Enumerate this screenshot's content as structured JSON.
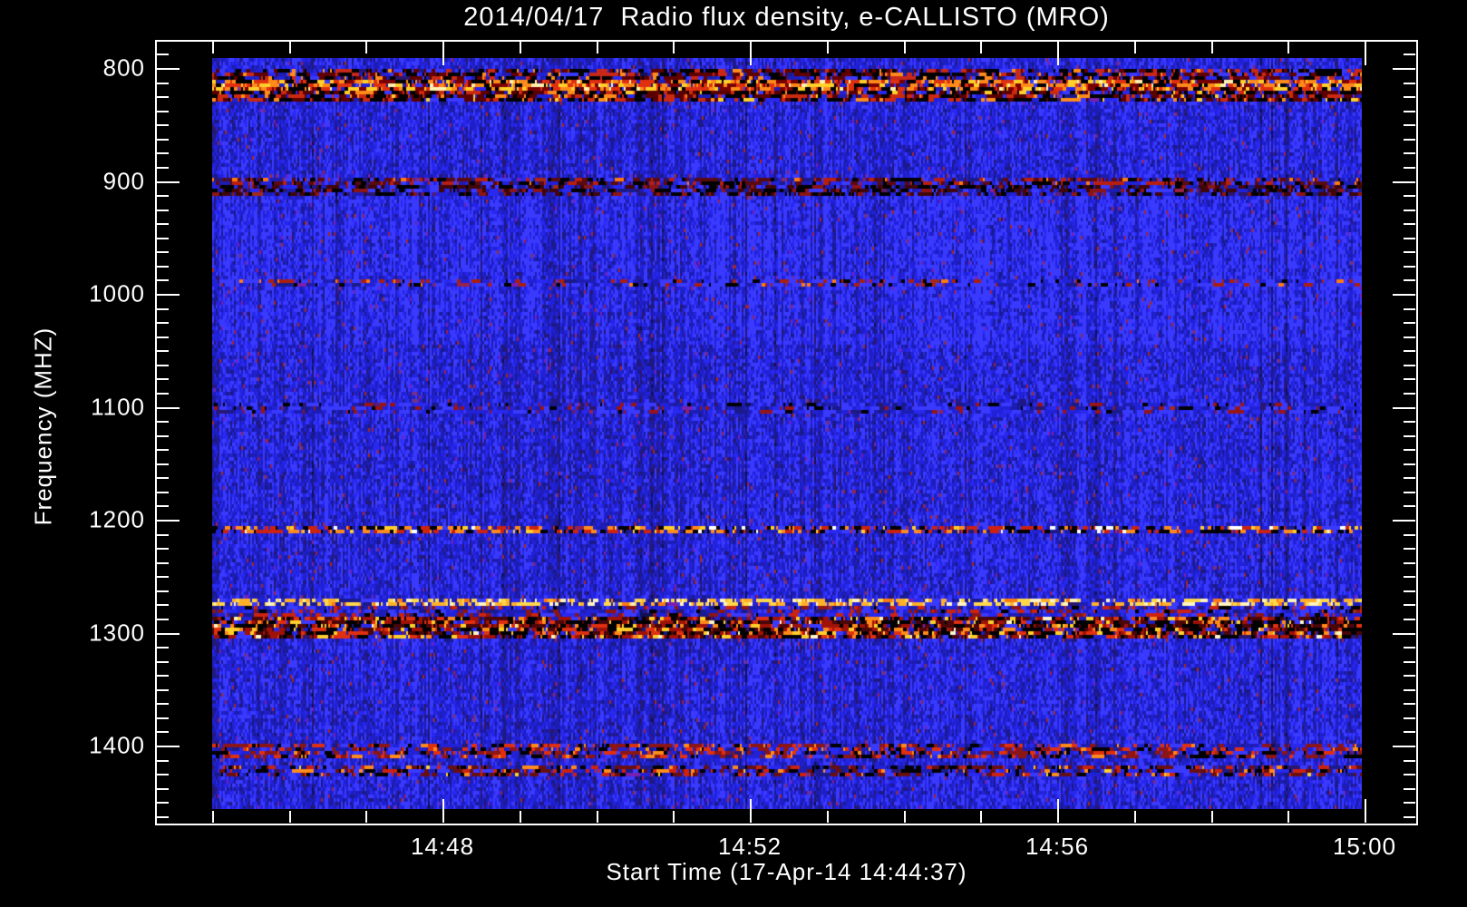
{
  "window": {
    "background_color": "#000000",
    "frame_color": "#ffffff",
    "text_color": "#ffffff"
  },
  "header": {
    "title": "2014/04/17  Radio flux density, e-CALLISTO (MRO)"
  },
  "chart_data": {
    "type": "heatmap",
    "title": "2014/04/17  Radio flux density, e-CALLISTO (MRO)",
    "xlabel": "Start Time (17-Apr-14 14:44:37)",
    "ylabel": "Frequency (MHZ)",
    "x_tick_labels": [
      "14:48",
      "14:52",
      "14:56",
      "15:00"
    ],
    "x_major_tick_minutes": [
      0,
      4,
      8,
      12
    ],
    "x_minor_tick_interval_minutes": 1,
    "x_data_span_minutes": [
      -3,
      12
    ],
    "y_tick_values_mhz": [
      800,
      900,
      1000,
      1100,
      1200,
      1300,
      1400
    ],
    "y_minor_tick_step_mhz": 12.5,
    "y_axis_orientation": "frequency increases downward",
    "y_axis_range_mhz": [
      777.5,
      1470
    ],
    "data_freq_range_mhz": [
      791,
      1456
    ],
    "legend": "none",
    "grid": "off",
    "background_noise": {
      "description": "quiet solar radio background: blue vertical-streak noise",
      "base_colors": [
        "#3a3aff",
        "#2828f0",
        "#2121d8",
        "#1d1db4",
        "#1a1a8a",
        "#2a176f",
        "#101055"
      ],
      "speck_colors": [
        "#7a1fae",
        "#99224a",
        "#a32a1a"
      ],
      "speck_probability": 0.015,
      "stripe_region_mhz": [
        914,
        1045
      ]
    },
    "rfi_bands": [
      {
        "freq_mhz": [
          800.0,
          809.5
        ],
        "strength": "medium-dark",
        "palette": [
          [
            "#000000",
            0.26
          ],
          [
            "#600000",
            0.18
          ],
          [
            "#c82818",
            0.16
          ],
          [
            "#ff8c1a",
            0.06
          ],
          [
            "bg",
            0.34
          ]
        ]
      },
      {
        "freq_mhz": [
          809.5,
          819.0
        ],
        "strength": "strong-bright",
        "palette": [
          [
            "#000000",
            0.15
          ],
          [
            "#7a0000",
            0.12
          ],
          [
            "#e03010",
            0.22
          ],
          [
            "#ff8c1a",
            0.2
          ],
          [
            "#ffd02a",
            0.14
          ],
          [
            "#fff2b0",
            0.05
          ],
          [
            "bg",
            0.12
          ]
        ]
      },
      {
        "freq_mhz": [
          819.0,
          829.0
        ],
        "strength": "strong-dark",
        "palette": [
          [
            "#000000",
            0.3
          ],
          [
            "#5a0000",
            0.22
          ],
          [
            "#cc2a10",
            0.18
          ],
          [
            "#ff8c1a",
            0.07
          ],
          [
            "#ffd02a",
            0.03
          ],
          [
            "bg",
            0.2
          ]
        ]
      },
      {
        "freq_mhz": [
          896.0,
          905.0
        ],
        "strength": "medium",
        "palette": [
          [
            "#000000",
            0.14
          ],
          [
            "#5a0a10",
            0.22
          ],
          [
            "#b81f10",
            0.14
          ],
          [
            "#ff7a10",
            0.04
          ],
          [
            "bg",
            0.46
          ]
        ]
      },
      {
        "freq_mhz": [
          905.0,
          914.5
        ],
        "strength": "medium-dark",
        "palette": [
          [
            "#000000",
            0.2
          ],
          [
            "#40060a",
            0.22
          ],
          [
            "#8c1515",
            0.12
          ],
          [
            "bg",
            0.46
          ]
        ]
      },
      {
        "freq_mhz": [
          986.5,
          993.0
        ],
        "strength": "faint",
        "palette": [
          [
            "#000000",
            0.08
          ],
          [
            "#aa1f10",
            0.12
          ],
          [
            "#ff7a10",
            0.03
          ],
          [
            "bg",
            0.77
          ]
        ]
      },
      {
        "freq_mhz": [
          1096.0,
          1105.0
        ],
        "strength": "very-faint",
        "palette": [
          [
            "#000000",
            0.06
          ],
          [
            "#991515",
            0.07
          ],
          [
            "bg",
            0.87
          ]
        ]
      },
      {
        "freq_mhz": [
          1205.5,
          1210.5
        ],
        "strength": "thin-speckle",
        "palette": [
          [
            "#000000",
            0.22
          ],
          [
            "#cc2210",
            0.2
          ],
          [
            "#ff8c1a",
            0.12
          ],
          [
            "#ffd02a",
            0.06
          ],
          [
            "#ffffff",
            0.04
          ],
          [
            "bg",
            0.36
          ]
        ]
      },
      {
        "freq_mhz": [
          1271.0,
          1275.5
        ],
        "strength": "bright-dashed",
        "palette": [
          [
            "#ffd84a",
            0.2
          ],
          [
            "#ffb02a",
            0.16
          ],
          [
            "#fff4c0",
            0.14
          ],
          [
            "#ff7a10",
            0.08
          ],
          [
            "bg",
            0.42
          ]
        ]
      },
      {
        "freq_mhz": [
          1277.0,
          1286.0
        ],
        "strength": "faint-mixed",
        "palette": [
          [
            "#8c1515",
            0.1
          ],
          [
            "#cc2210",
            0.08
          ],
          [
            "#000000",
            0.06
          ],
          [
            "bg",
            0.76
          ]
        ]
      },
      {
        "freq_mhz": [
          1287.0,
          1304.0
        ],
        "strength": "strong-dark",
        "palette": [
          [
            "#000000",
            0.26
          ],
          [
            "#4a0608",
            0.18
          ],
          [
            "#a01208",
            0.14
          ],
          [
            "#e03010",
            0.12
          ],
          [
            "#ff8c1a",
            0.08
          ],
          [
            "#ffd02a",
            0.06
          ],
          [
            "#fff6c8",
            0.02
          ],
          [
            "bg",
            0.14
          ]
        ]
      },
      {
        "freq_mhz": [
          1399.0,
          1410.0
        ],
        "strength": "medium-speckle",
        "palette": [
          [
            "#000000",
            0.12
          ],
          [
            "#8c1515",
            0.16
          ],
          [
            "#e03010",
            0.14
          ],
          [
            "#ff8c1a",
            0.04
          ],
          [
            "bg",
            0.54
          ]
        ]
      },
      {
        "freq_mhz": [
          1417.0,
          1428.0
        ],
        "strength": "medium-speckle",
        "palette": [
          [
            "#000000",
            0.14
          ],
          [
            "#6a0f10",
            0.16
          ],
          [
            "#cc2210",
            0.14
          ],
          [
            "#ff8c1a",
            0.05
          ],
          [
            "#ffd02a",
            0.02
          ],
          [
            "bg",
            0.49
          ]
        ]
      }
    ]
  }
}
